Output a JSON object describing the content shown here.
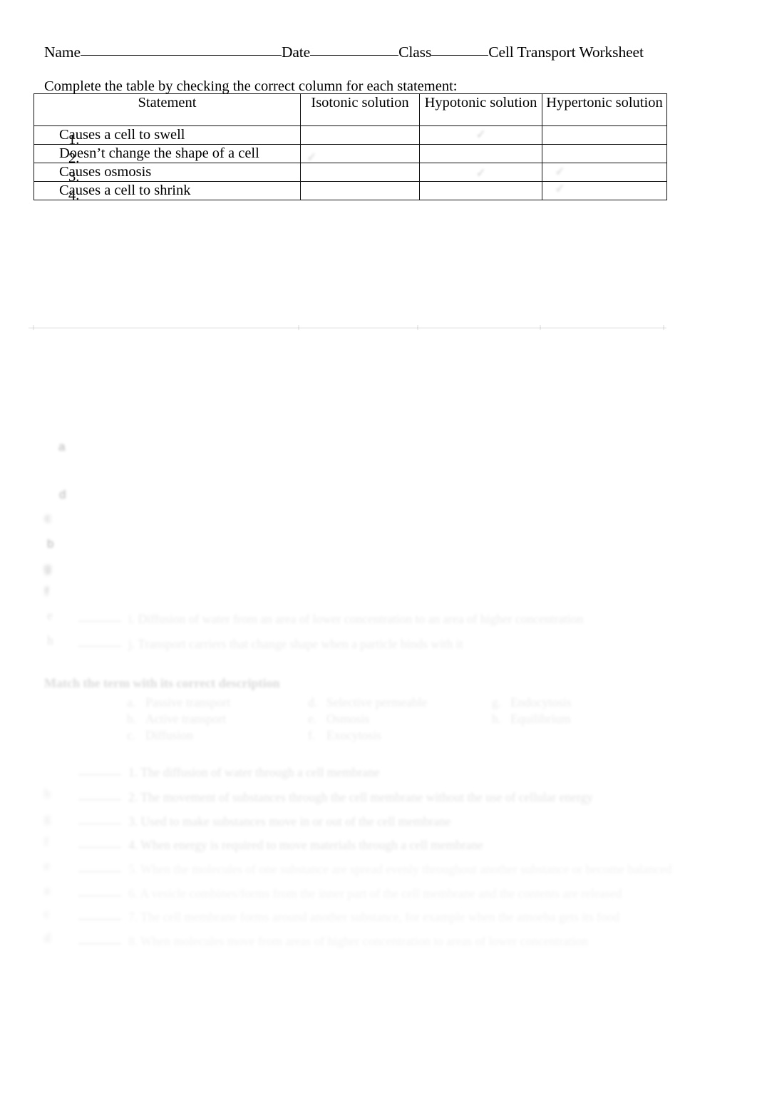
{
  "document": {
    "title": "Cell Transport Worksheet",
    "header": {
      "name_label": "Name",
      "date_label": "Date",
      "class_label": "Class",
      "worksheet_title": "Cell Transport Worksheet"
    },
    "instruction": "Complete the table by  checking the correct column for each statement:"
  },
  "table": {
    "columns": [
      "Statement",
      "Isotonic solution",
      "Hypotonic solution",
      "Hypertonic solution"
    ],
    "rows": [
      {
        "number": "1.",
        "statement": "Causes a cell to swell",
        "isotonic": "",
        "hypotonic": "✓",
        "hypertonic": ""
      },
      {
        "number": "2.",
        "statement": "Doesn’t change the shape of a cell",
        "isotonic": "✓",
        "hypotonic": "",
        "hypertonic": ""
      },
      {
        "number": "3.",
        "statement": "Causes osmosis",
        "isotonic": "",
        "hypotonic": "✓",
        "hypertonic": "✓"
      },
      {
        "number": "4.",
        "statement": "Causes a cell to shrink",
        "isotonic": "",
        "hypotonic": "",
        "hypertonic": "✓"
      }
    ]
  },
  "faded_section_a": {
    "items": [
      {
        "answer": "",
        "text": "i.  Diffusion of water from an area of lower concentration to an area of higher concentration"
      },
      {
        "answer": "",
        "text": "j.  Transport carriers that change shape when a particle binds with it"
      }
    ]
  },
  "matching": {
    "heading": "Match the term with its correct description",
    "word_bank": {
      "column_1": [
        {
          "letter": "a.",
          "term": "Passive transport"
        },
        {
          "letter": "b.",
          "term": "Active transport"
        },
        {
          "letter": "c.",
          "term": "Diffusion"
        }
      ],
      "column_2": [
        {
          "letter": "d.",
          "term": "Selective permeable"
        },
        {
          "letter": "e.",
          "term": "Osmosis"
        },
        {
          "letter": "f.",
          "term": "Exocytosis"
        }
      ],
      "column_3": [
        {
          "letter": "g.",
          "term": "Endocytosis"
        },
        {
          "letter": "h.",
          "term": "Equilibrium"
        }
      ]
    },
    "questions": [
      {
        "answer": "",
        "text": "1.  The diffusion of water through a cell membrane"
      },
      {
        "answer": "b",
        "text": "2.  The movement of substances through the cell membrane without the use of cellular energy"
      },
      {
        "answer": "g",
        "text": "3.  Used to make substances move in or out of the cell membrane"
      },
      {
        "answer": "f",
        "text": "4.  When energy is required to move materials through a cell membrane"
      },
      {
        "answer": "e",
        "text": "5.  When the molecules of one substance are spread evenly throughout another substance or become balanced"
      },
      {
        "answer": "a",
        "text": "6.  A vesicle combines/forms from the inner part of the cell membrane and the contents are released"
      },
      {
        "answer": "c",
        "text": "7.  The cell membrane forms around another substance, for example when the amoeba gets its food"
      },
      {
        "answer": "d",
        "text": "8.  When molecules move from areas of higher concentration to areas of lower concentration"
      }
    ]
  },
  "stray_marks": {
    "margin_notes": [
      "a",
      "d",
      "c",
      "b",
      "g",
      "f",
      "e",
      "h"
    ]
  }
}
